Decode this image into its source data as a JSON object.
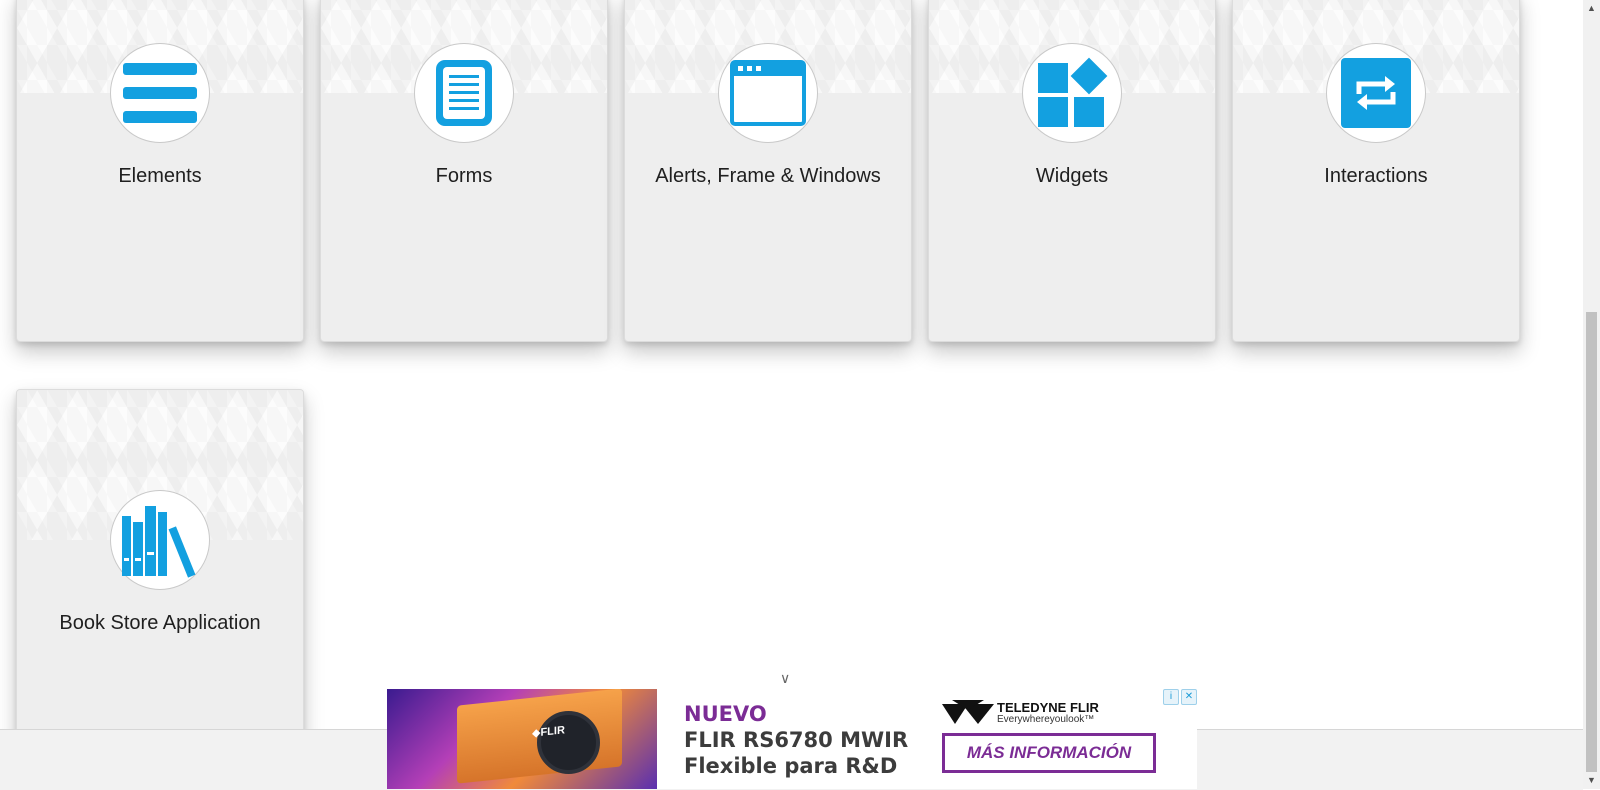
{
  "cards": [
    {
      "id": "elements",
      "label": "Elements",
      "icon": "hamburger-menu-icon"
    },
    {
      "id": "forms",
      "label": "Forms",
      "icon": "document-icon"
    },
    {
      "id": "alerts",
      "label": "Alerts, Frame & Windows",
      "icon": "browser-window-icon"
    },
    {
      "id": "widgets",
      "label": "Widgets",
      "icon": "widgets-icon"
    },
    {
      "id": "interactions",
      "label": "Interactions",
      "icon": "repeat-arrows-icon"
    },
    {
      "id": "bookstore",
      "label": "Book Store Application",
      "icon": "books-icon"
    }
  ],
  "colors": {
    "accent": "#13a0e0",
    "card_bg": "#eeeeee",
    "ad_purple": "#7b2c95"
  },
  "ad": {
    "line1": "NUEVO",
    "line2": "FLIR RS6780 MWIR",
    "line3": "Flexible para R&D",
    "brand_on_camera": "◆FLIR",
    "logo_name": "TELEDYNE FLIR",
    "logo_tagline": "Everywhereyoulook™",
    "cta": "MÁS INFORMACIÓN",
    "info_glyph": "i",
    "close_glyph": "✕",
    "collapse_glyph": "∨"
  },
  "scrollbar": {
    "up_arrow": "▲",
    "down_arrow": "▼"
  }
}
